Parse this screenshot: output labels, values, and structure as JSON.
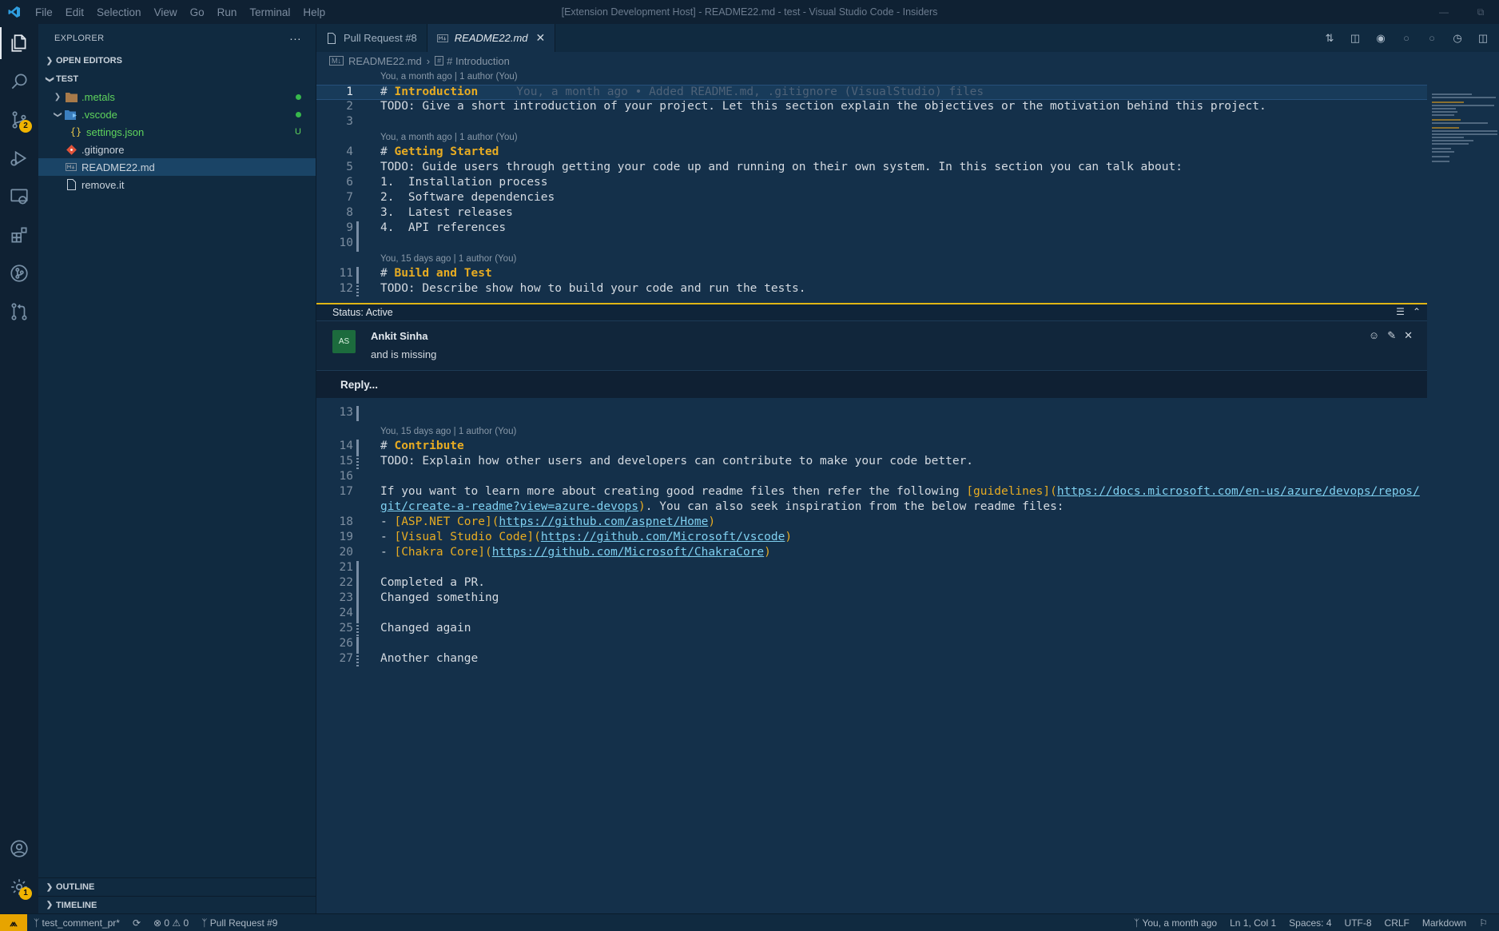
{
  "titlebar": {
    "menu": [
      "File",
      "Edit",
      "Selection",
      "View",
      "Go",
      "Run",
      "Terminal",
      "Help"
    ],
    "title": "[Extension Development Host] - README22.md - test - Visual Studio Code - Insiders"
  },
  "activity": {
    "scm_badge": "2",
    "settings_badge": "1"
  },
  "sidebar": {
    "title": "EXPLORER",
    "more": "···",
    "open_editors": "OPEN EDITORS",
    "workspace": "TEST",
    "tree": [
      {
        "label": ".metals",
        "status": ""
      },
      {
        "label": ".vscode",
        "status": ""
      },
      {
        "label": "settings.json",
        "status": "U"
      },
      {
        "label": ".gitignore",
        "status": ""
      },
      {
        "label": "README22.md",
        "status": ""
      },
      {
        "label": "remove.it",
        "status": ""
      }
    ],
    "outline": "OUTLINE",
    "timeline": "TIMELINE"
  },
  "tabs": [
    {
      "label": "Pull Request #8"
    },
    {
      "label": "README22.md"
    }
  ],
  "breadcrumb": {
    "file": "README22.md",
    "symbol": "# Introduction"
  },
  "editor": {
    "lens_1": "You, a month ago | 1 author (You)",
    "lens_2": "You, a month ago | 1 author (You)",
    "lens_3": "You, 15 days ago | 1 author (You)",
    "lens_4": "You, 15 days ago | 1 author (You)",
    "blame": "You, a month ago • Added README.md, .gitignore (VisualStudio) files",
    "l1_heading": "Introduction",
    "l2": "TODO: Give a short introduction of your project. Let this section explain the objectives or the motivation behind this project.",
    "l4_heading": "Getting Started",
    "l5": "TODO: Guide users through getting your code up and running on their own system. In this section you can talk about:",
    "l6": "1.  Installation process",
    "l7": "2.  Software dependencies",
    "l8": "3.  Latest releases",
    "l9": "4.  API references",
    "l11_heading": "Build and Test",
    "l12": "TODO: Describe show how to build your code and run the tests.",
    "l14_heading": "Contribute",
    "l15": "TODO: Explain how other users and developers can contribute to make your code better.",
    "l17_pre": "If you want to learn more about creating good readme files then refer the following ",
    "l17_link": "[guidelines]",
    "l17_url": "https://docs.microsoft.com/en-us/azure/devops/repos/",
    "l17b_url": "git/create-a-readme?view=azure-devops",
    "l17b_post": ". You can also seek inspiration from the below readme files:",
    "l18_link": "[ASP.NET Core]",
    "l18_url": "https://github.com/aspnet/Home",
    "l19_link": "[Visual Studio Code]",
    "l19_url": "https://github.com/Microsoft/vscode",
    "l20_link": "[Chakra Core]",
    "l20_url": "https://github.com/Microsoft/ChakraCore",
    "l22": "Completed a PR.",
    "l23": "Changed something",
    "l25": "Changed again",
    "l27": "Another change"
  },
  "comment": {
    "status": "Status: Active",
    "avatar": "AS",
    "author": "Ankit Sinha",
    "body": "and is missing",
    "reply": "Reply..."
  },
  "status": {
    "branch": "test_comment_pr*",
    "problems": "0",
    "warnings": "0",
    "pr": "Pull Request #9",
    "blame": "You, a month ago",
    "position": "Ln 1, Col 1",
    "spaces": "Spaces: 4",
    "encoding": "UTF-8",
    "eol": "CRLF",
    "language": "Markdown"
  }
}
